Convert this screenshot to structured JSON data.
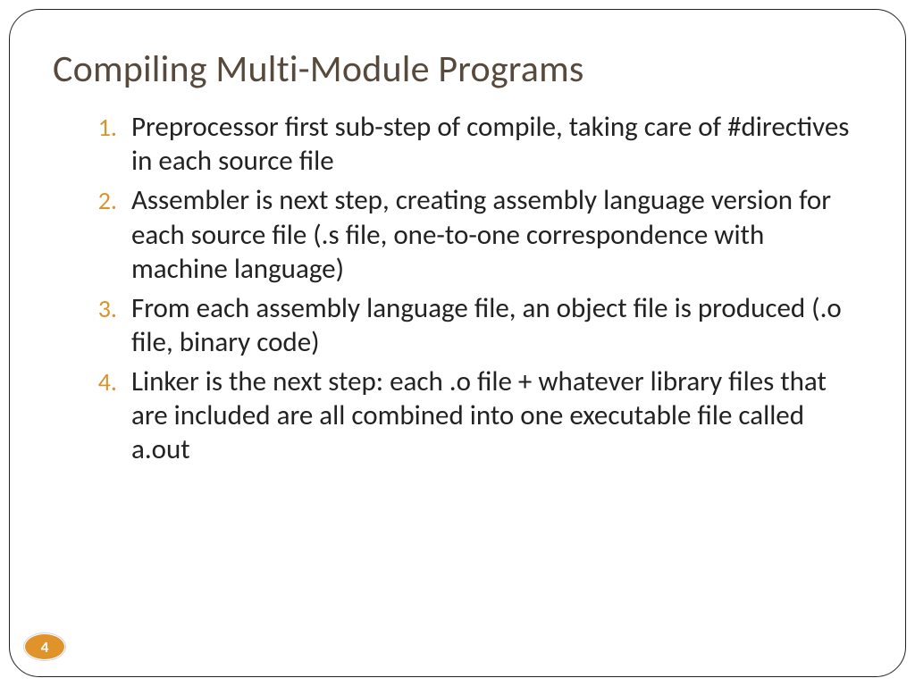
{
  "title": "Compiling Multi-Module Programs",
  "items": [
    {
      "num": "1.",
      "text": "Preprocessor first sub-step of compile, taking care of #directives in each source file"
    },
    {
      "num": "2.",
      "text": "Assembler is next step, creating assembly language version for each source file (.s file, one-to-one correspondence with machine language)"
    },
    {
      "num": "3.",
      "text": "From each assembly language file, an object file is produced (.o file, binary code)"
    },
    {
      "num": "4.",
      "text": "Linker is the next step:  each .o file + whatever library files that are included are all combined into one executable file called a.out"
    }
  ],
  "page_number": "4"
}
